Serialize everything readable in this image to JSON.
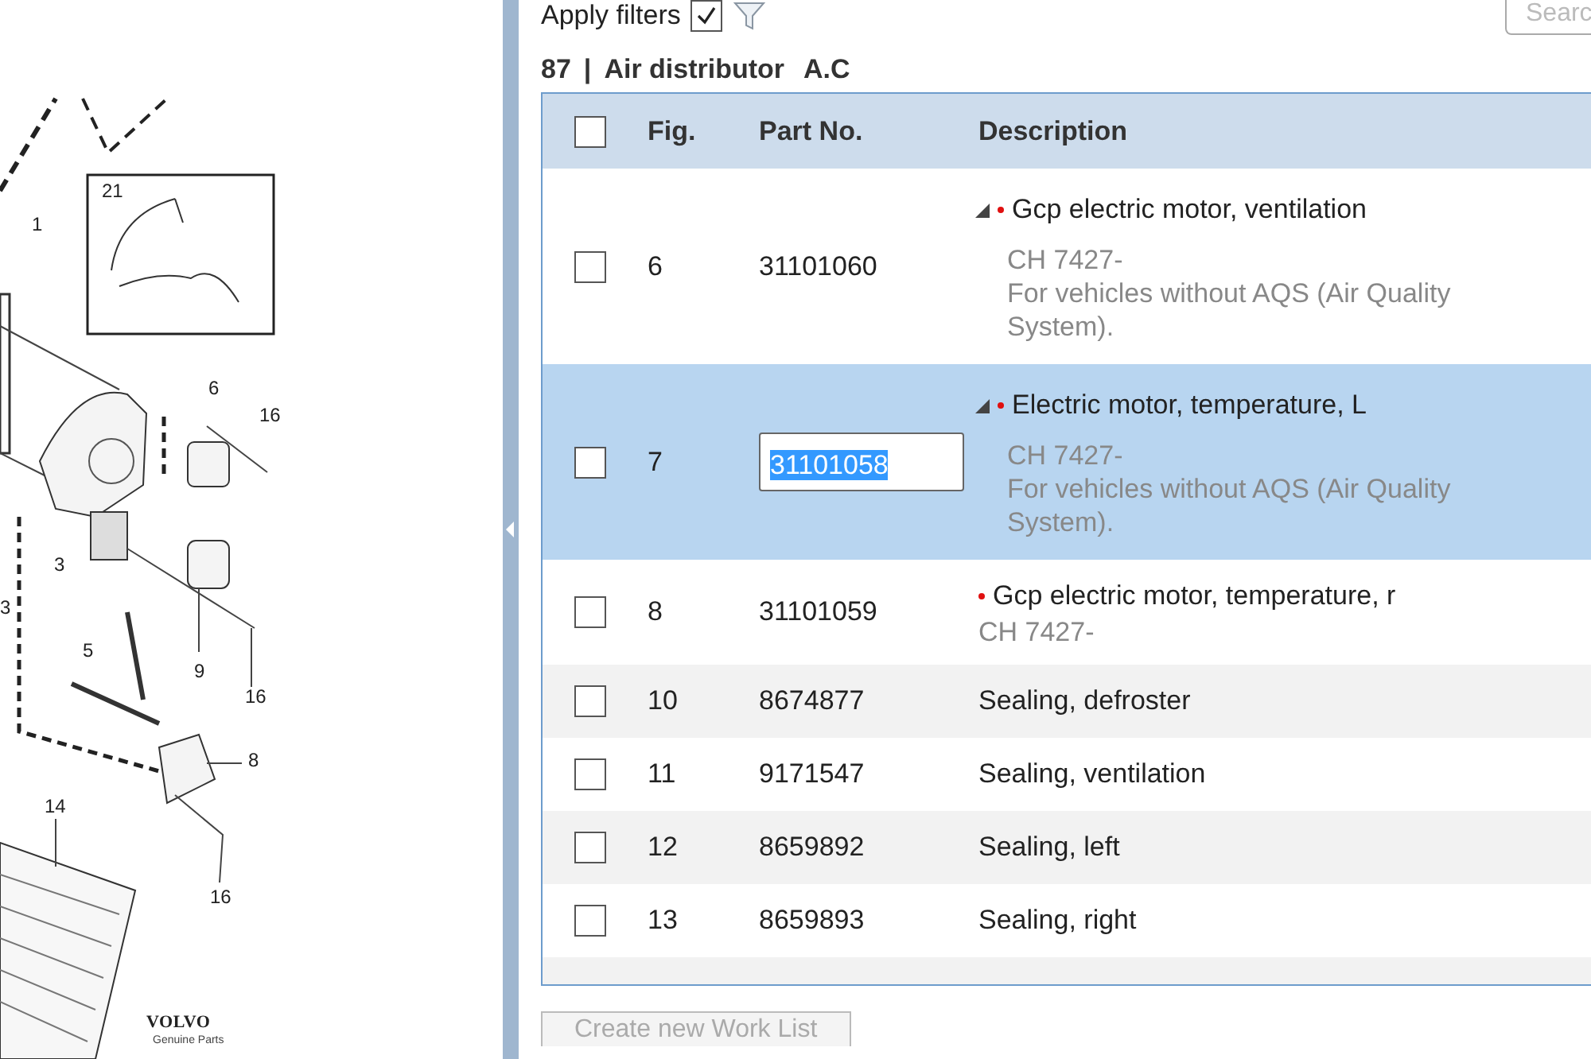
{
  "diagram": {
    "callouts": [
      "1",
      "21",
      "6",
      "16",
      "3",
      "3",
      "9",
      "16",
      "5",
      "8",
      "14",
      "16"
    ],
    "brand": "VOLVO",
    "brand_sub": "Genuine Parts"
  },
  "filters": {
    "label": "Apply filters",
    "checked": true,
    "search_placeholder": "Searc"
  },
  "heading": {
    "number": "87",
    "separator": "|",
    "title": "Air distributor",
    "suffix": "A.C"
  },
  "table": {
    "header_checked": false,
    "columns": [
      "Fig.",
      "Part No.",
      "Description"
    ],
    "rows": [
      {
        "fig": "6",
        "part_no": "31101060",
        "description": "Gcp electric motor, ventilation",
        "notes": [
          "CH 7427-",
          "For vehicles without AQS (Air Quality System)."
        ],
        "expandable": true,
        "flagged": true,
        "selected": false,
        "editing": false,
        "checked": false
      },
      {
        "fig": "7",
        "part_no": "31101058",
        "description": "Electric motor, temperature, L",
        "notes": [
          "CH 7427-",
          "For vehicles without AQS (Air Quality System)."
        ],
        "expandable": true,
        "flagged": true,
        "selected": true,
        "editing": true,
        "checked": false
      },
      {
        "fig": "8",
        "part_no": "31101059",
        "description": "Gcp electric motor, temperature, r",
        "notes": [
          "CH 7427-"
        ],
        "expandable": false,
        "flagged": true,
        "selected": false,
        "editing": false,
        "checked": false
      },
      {
        "fig": "10",
        "part_no": "8674877",
        "description": "Sealing, defroster",
        "expandable": false,
        "flagged": false,
        "selected": false,
        "editing": false,
        "checked": false
      },
      {
        "fig": "11",
        "part_no": "9171547",
        "description": "Sealing, ventilation",
        "expandable": false,
        "flagged": false,
        "selected": false,
        "editing": false,
        "checked": false
      },
      {
        "fig": "12",
        "part_no": "8659892",
        "description": "Sealing, left",
        "expandable": false,
        "flagged": false,
        "selected": false,
        "editing": false,
        "checked": false
      },
      {
        "fig": "13",
        "part_no": "8659893",
        "description": "Sealing, right",
        "expandable": false,
        "flagged": false,
        "selected": false,
        "editing": false,
        "checked": false
      }
    ]
  },
  "actions": {
    "create_button": "Create new Work List"
  }
}
